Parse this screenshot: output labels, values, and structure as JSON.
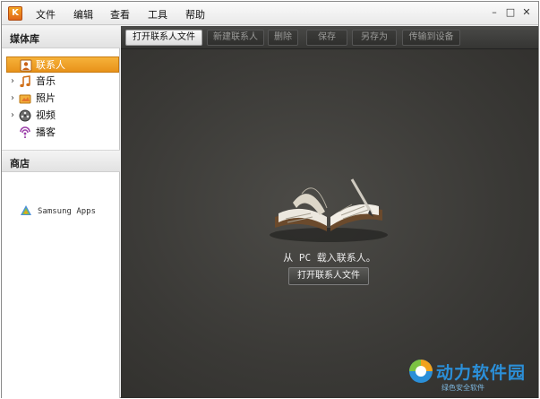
{
  "app": {
    "logo_text": "K"
  },
  "menu": [
    "文件",
    "编辑",
    "查看",
    "工具",
    "帮助"
  ],
  "window_controls": {
    "minimize": "–",
    "maximize": "□",
    "close": "✕"
  },
  "sidebar": {
    "media_header": "媒体库",
    "items": [
      {
        "label": "联系人",
        "selected": true,
        "expandable": false,
        "icon": "contact-card-icon"
      },
      {
        "label": "音乐",
        "selected": false,
        "expandable": true,
        "icon": "music-note-icon"
      },
      {
        "label": "照片",
        "selected": false,
        "expandable": true,
        "icon": "photo-folder-icon"
      },
      {
        "label": "视频",
        "selected": false,
        "expandable": true,
        "icon": "film-reel-icon"
      },
      {
        "label": "播客",
        "selected": false,
        "expandable": false,
        "icon": "podcast-icon"
      }
    ],
    "store_header": "商店",
    "store_items": [
      {
        "label": "Samsung Apps",
        "icon": "samsung-apps-icon"
      }
    ]
  },
  "toolbar": {
    "buttons": [
      {
        "label": "打开联系人文件",
        "enabled": true
      },
      {
        "label": "新建联系人",
        "enabled": false
      },
      {
        "label": "删除",
        "enabled": false
      },
      {
        "label": "保存",
        "enabled": false
      },
      {
        "label": "另存为",
        "enabled": false
      },
      {
        "label": "传输到设备",
        "enabled": false
      }
    ]
  },
  "main": {
    "load_text": "从 PC 载入联系人。",
    "open_button_label": "打开联系人文件"
  },
  "watermark": {
    "text": "动力软件园",
    "sub": "绿色安全软件"
  },
  "colors": {
    "selection": "#e8921a",
    "content_bg": "#3a3936",
    "toolbar_bg": "#353533"
  }
}
